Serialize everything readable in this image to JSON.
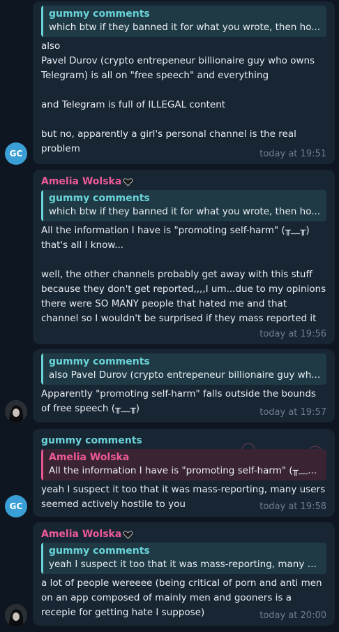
{
  "colors": {
    "background": "#0e1621",
    "bubble": "#182533",
    "gummy_accent": "#6ad3d8",
    "amelia_accent": "#ee5a98",
    "avatar_gc": "#3a9fd6",
    "timestamp": "#6d7f8f"
  },
  "messages": [
    {
      "sender": "",
      "avatar": "GC",
      "reply": {
        "name": "gummy comments",
        "text": "which btw  if they banned it for what you wrote, then ho..."
      },
      "body": [
        "also\nPavel Durov (crypto entrepeneur billionaire guy who owns Telegram) is all on \"free speech\" and everything",
        "and Telegram is full of ILLEGAL content",
        "but no, apparently a girl's personal channel is the real problem"
      ],
      "time": "today at 19:51"
    },
    {
      "sender": "Amelia Wolska",
      "avatar": "",
      "reply": {
        "name": "gummy comments",
        "text": "which btw  if they banned it for what you wrote, then ho..."
      },
      "body": [
        "All the information I have is \"promoting self-harm\" (╥﹏╥)\nthat's all I know...",
        "well, the other channels probably get away with this stuff because they don't get reported,,,,I um...due to my opinions there were SO MANY people that hated me and that channel so I wouldn't be surprised if they mass reported it"
      ],
      "time": "today at 19:56"
    },
    {
      "sender": "",
      "avatar": "photo",
      "reply": {
        "name": "gummy comments",
        "text": "also Pavel Durov (crypto entrepeneur billionaire guy wh..."
      },
      "body": [
        "Apparently \"promoting self-harm\" falls outside the bounds of free speech (╥﹏╥)"
      ],
      "time": "today at 19:57"
    },
    {
      "sender": "gummy comments",
      "avatar": "GC",
      "reply": {
        "name": "Amelia Wolska",
        "text": "All the information I have is \"promoting self-harm\" (╥﹏..."
      },
      "body": [
        "yeah I suspect it too that it was mass-reporting, many users seemed actively hostile to you"
      ],
      "time": "today at 19:58"
    },
    {
      "sender": "Amelia Wolska",
      "avatar": "photo",
      "reply": {
        "name": "gummy comments",
        "text": "yeah I suspect it too that it was mass-reporting, many us..."
      },
      "body": [
        "a lot of people wereeee (being critical of porn and anti men on an app composed of mainly men and gooners is a recepie for getting hate I suppose)"
      ],
      "time": "today at 20:00"
    }
  ]
}
